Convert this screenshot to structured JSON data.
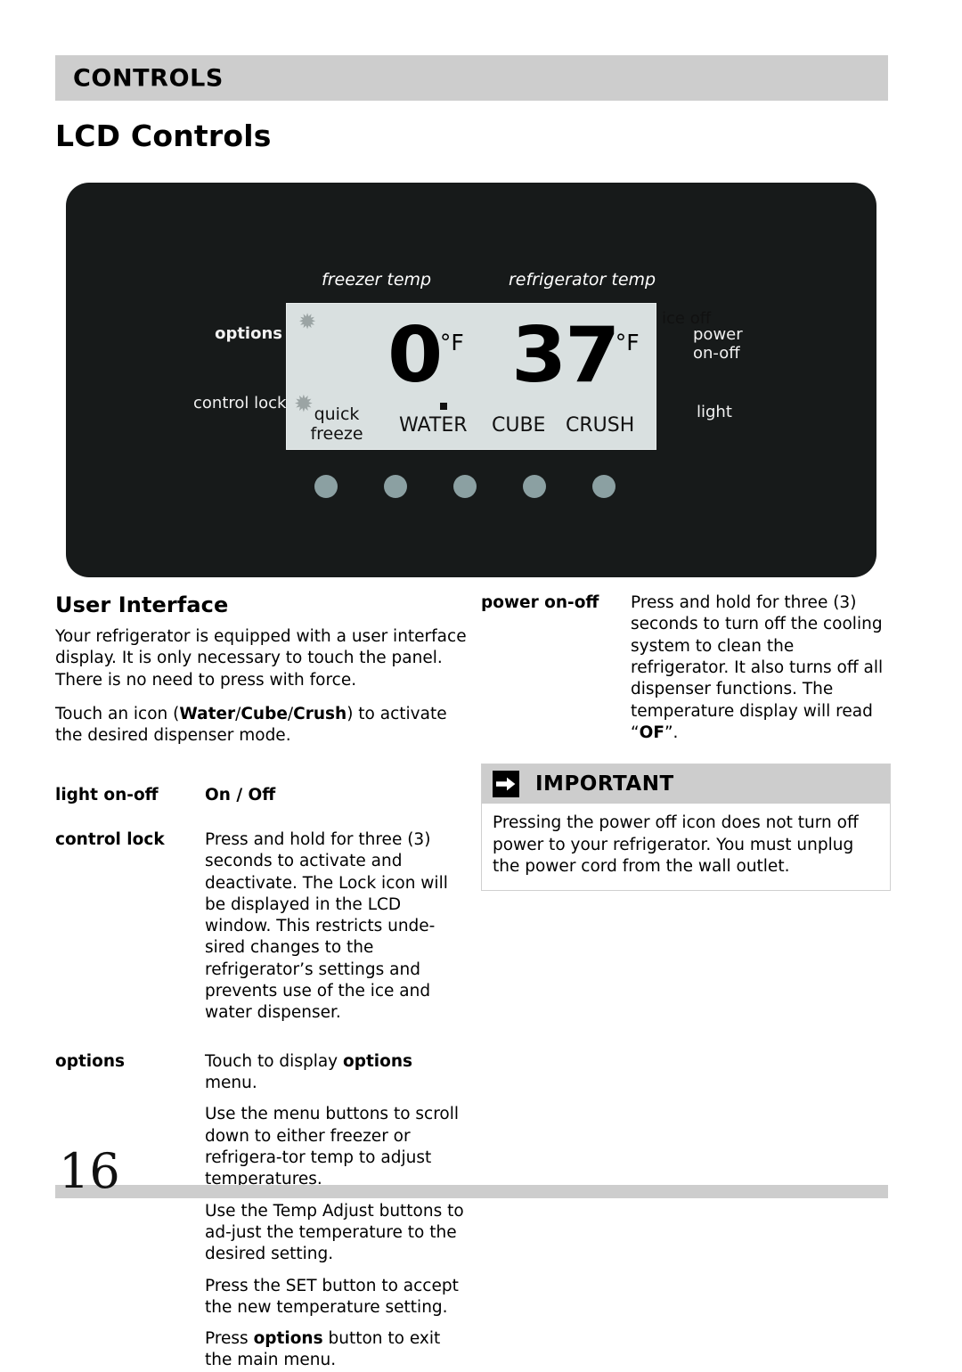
{
  "header": {
    "section_title": "CONTROLS",
    "page_title": "LCD Controls"
  },
  "control_panel": {
    "captions": {
      "freezer_temp": "freezer temp",
      "refrigerator_temp": "refrigerator temp"
    },
    "side_labels": {
      "options": "options",
      "control_lock": "control lock",
      "power_on_off": "power\non-off",
      "power_line1": "power",
      "power_line2": "on-off",
      "light": "light"
    },
    "lcd": {
      "freezer_value": "0",
      "freezer_unit": "°F",
      "refrigerator_value": "37",
      "refrigerator_unit": "°F",
      "quick_freeze": "quick\nfreeze",
      "quick_freeze_line1": "quick",
      "quick_freeze_line2": "freeze",
      "snowflake_glyph": "✹",
      "modes": [
        "WATER",
        "CUBE",
        "CRUSH"
      ],
      "ice_off": "ice off",
      "active_mode_indicator": "WATER",
      "lcd_background_color": "#d9e0e0",
      "panel_background_color": "#171a1a"
    },
    "touch_buttons": {
      "count": 5,
      "color": "#8ba0a2"
    }
  },
  "left_column": {
    "heading": "User Interface",
    "paragraphs": [
      "Your refrigerator is equipped with a user interface display. It is only necessary to touch the panel.  There is no need to press with force.",
      "Touch an icon (Water/Cube/Crush) to activate the desired dispenser mode."
    ],
    "definitions": [
      {
        "term": "light on-off",
        "lines": [
          "On / Off"
        ],
        "desc_bold": true
      },
      {
        "term": "control lock",
        "lines": [
          "Press and hold for three (3) seconds to activate and deactivate.  The Lock icon will be displayed in the LCD window.  This restricts unde-sired changes to the refrigerator’s settings and prevents use of the ice and water dispenser."
        ],
        "desc_bold": false
      },
      {
        "term": "options",
        "lines": [
          "Touch to display options menu.",
          "Use the menu buttons to scroll down to either freezer or refrigera-tor temp to adjust temperatures.",
          "Use the Temp Adjust buttons to ad-just the temperature to the desired setting.",
          "Press the SET button to accept the new temperature setting.",
          "Press options button to exit the main menu."
        ],
        "desc_bold": false
      }
    ]
  },
  "right_column": {
    "definitions": [
      {
        "term": "power on-off",
        "lines": [
          "Press and hold for three (3) seconds to turn off the cooling system to clean the refrigerator.  It also turns off all dispenser functions. The tem-perature display will read “OF”."
        ]
      }
    ],
    "important": {
      "title": "IMPORTANT",
      "body": "Pressing the power off icon does not turn off power to your refrigerator. You must unplug the power cord from the wall outlet."
    }
  },
  "footer": {
    "page_number": "16"
  }
}
